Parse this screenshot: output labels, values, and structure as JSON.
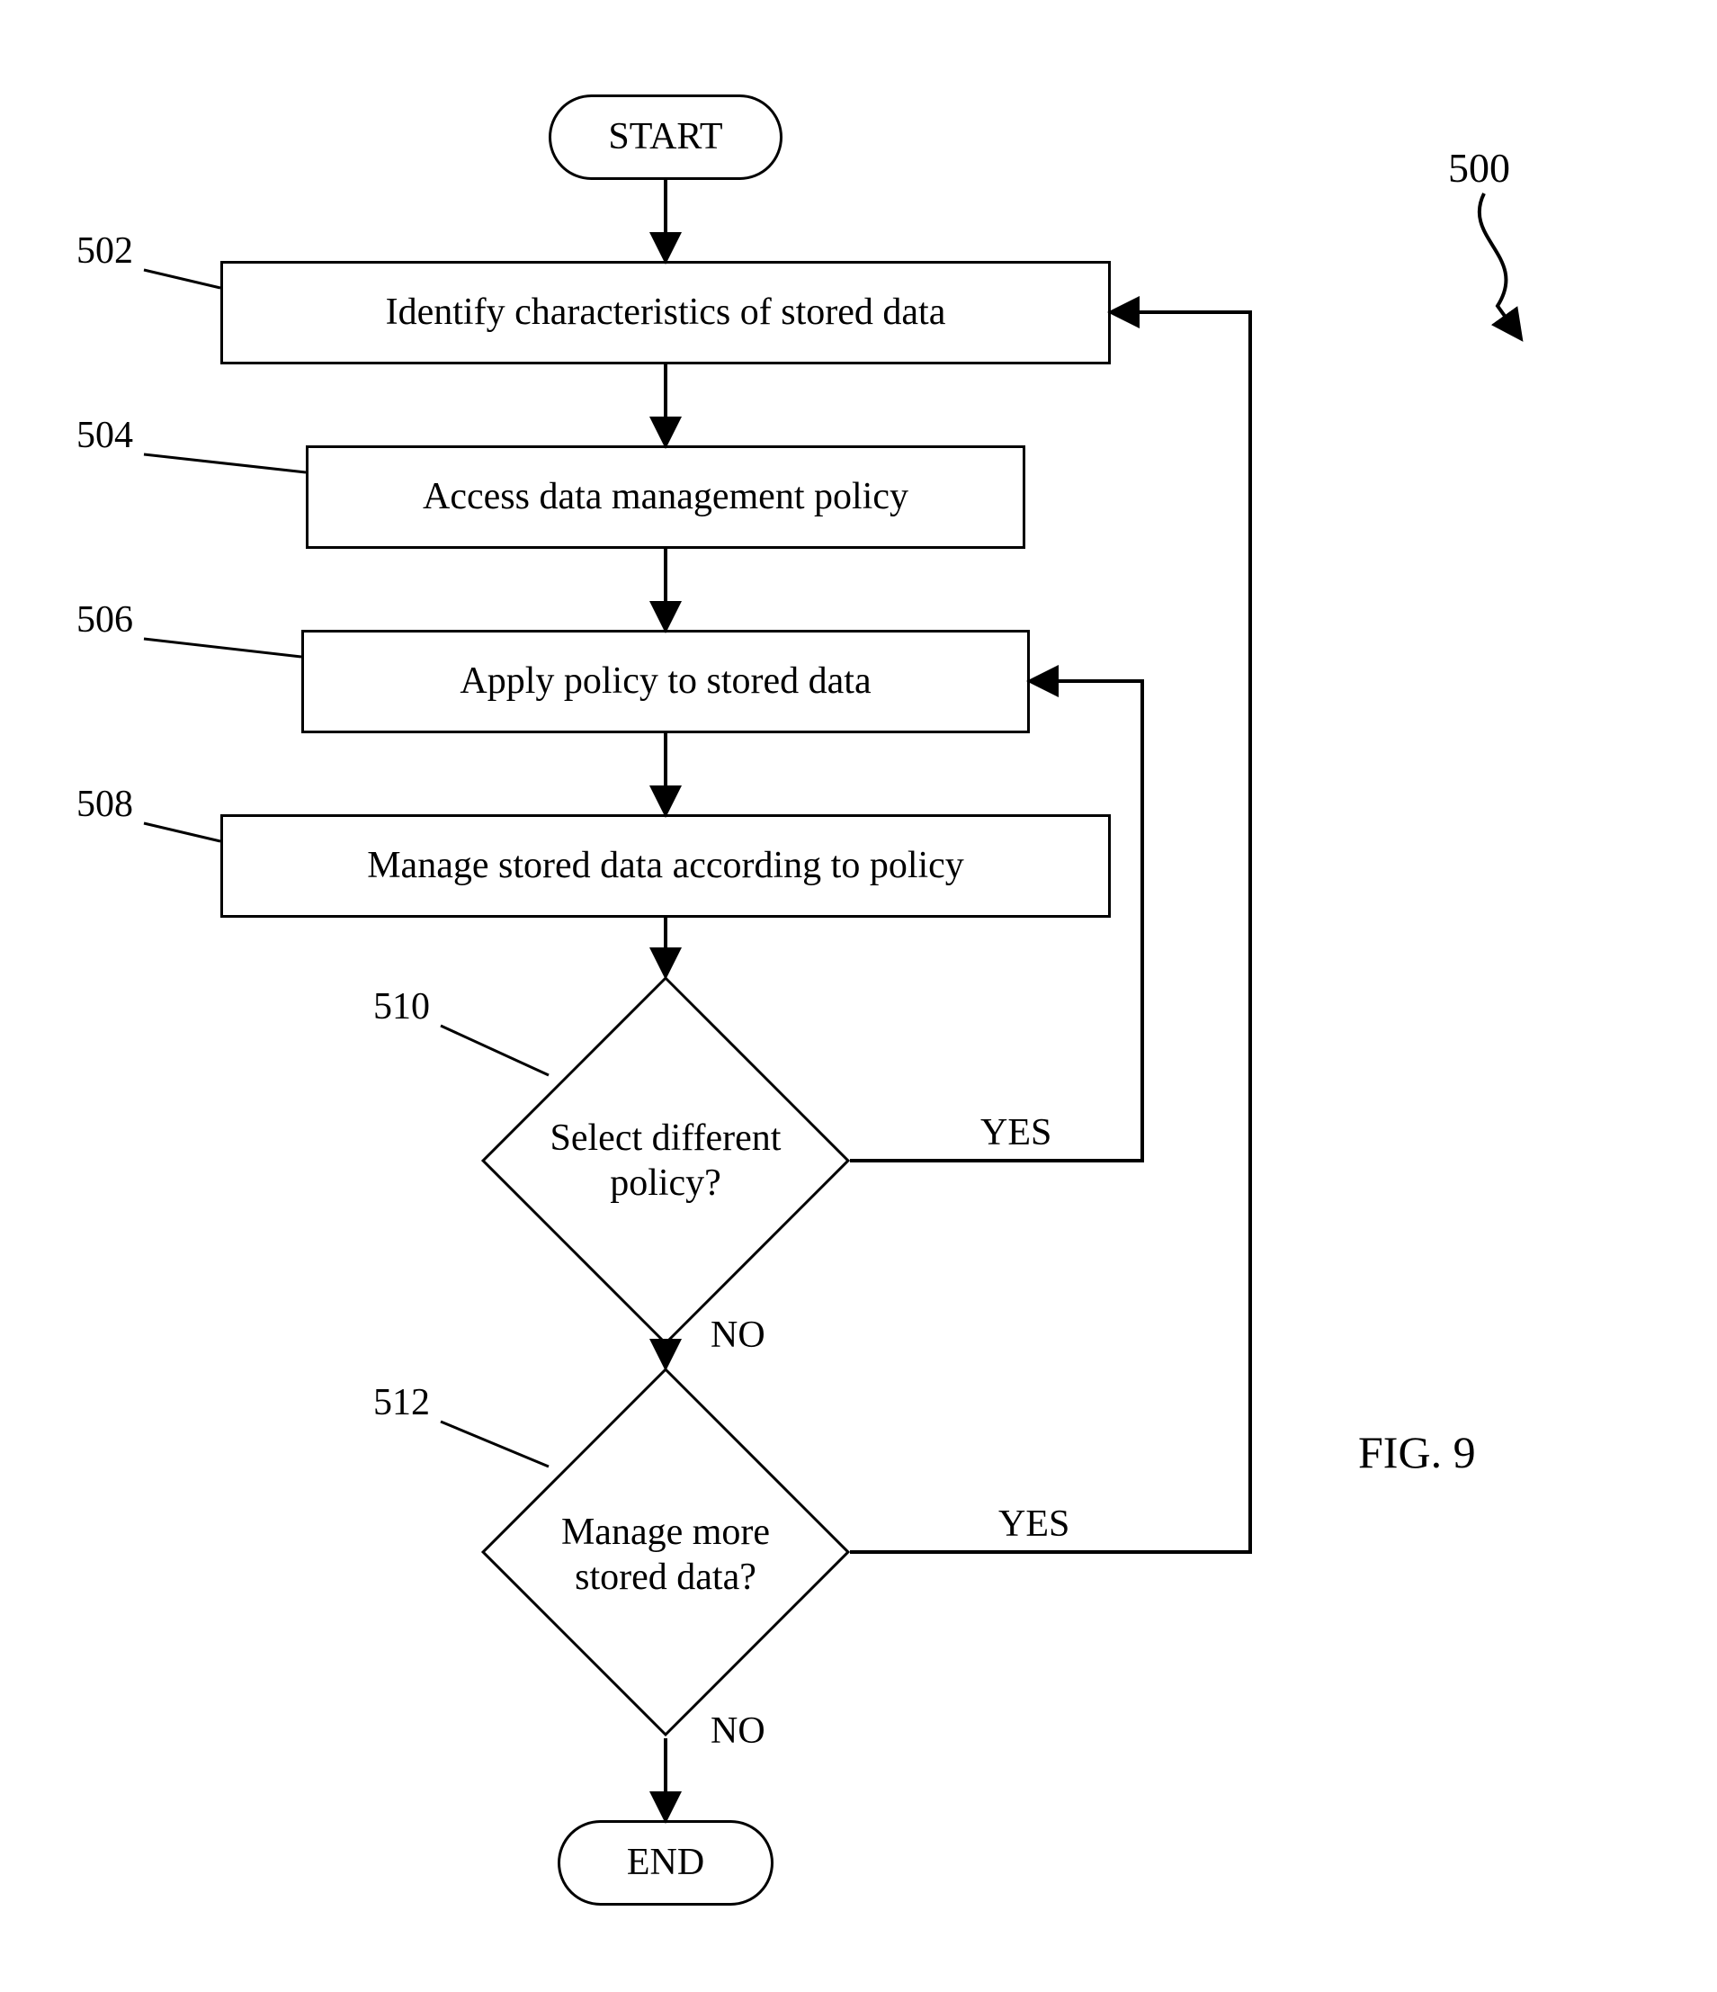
{
  "figure_label": "FIG. 9",
  "figure_ref": "500",
  "terminators": {
    "start": "START",
    "end": "END"
  },
  "steps": {
    "502": {
      "ref": "502",
      "text": "Identify characteristics of stored data"
    },
    "504": {
      "ref": "504",
      "text": "Access data management policy"
    },
    "506": {
      "ref": "506",
      "text": "Apply policy to stored data"
    },
    "508": {
      "ref": "508",
      "text": "Manage stored data according to policy"
    }
  },
  "decisions": {
    "510": {
      "ref": "510",
      "text": "Select different policy?",
      "yes": "YES",
      "no": "NO"
    },
    "512": {
      "ref": "512",
      "text": "Manage more stored data?",
      "yes": "YES",
      "no": "NO"
    }
  },
  "chart_data": {
    "type": "flowchart",
    "nodes": [
      {
        "id": "start",
        "kind": "terminator",
        "label": "START"
      },
      {
        "id": "502",
        "kind": "process",
        "label": "Identify characteristics of stored data"
      },
      {
        "id": "504",
        "kind": "process",
        "label": "Access data management policy"
      },
      {
        "id": "506",
        "kind": "process",
        "label": "Apply policy to stored data"
      },
      {
        "id": "508",
        "kind": "process",
        "label": "Manage stored data according to policy"
      },
      {
        "id": "510",
        "kind": "decision",
        "label": "Select different policy?"
      },
      {
        "id": "512",
        "kind": "decision",
        "label": "Manage more stored data?"
      },
      {
        "id": "end",
        "kind": "terminator",
        "label": "END"
      }
    ],
    "edges": [
      {
        "from": "start",
        "to": "502"
      },
      {
        "from": "502",
        "to": "504"
      },
      {
        "from": "504",
        "to": "506"
      },
      {
        "from": "506",
        "to": "508"
      },
      {
        "from": "508",
        "to": "510"
      },
      {
        "from": "510",
        "to": "506",
        "label": "YES"
      },
      {
        "from": "510",
        "to": "512",
        "label": "NO"
      },
      {
        "from": "512",
        "to": "502",
        "label": "YES"
      },
      {
        "from": "512",
        "to": "end",
        "label": "NO"
      }
    ],
    "figure_number": "500",
    "title": "FIG. 9"
  }
}
